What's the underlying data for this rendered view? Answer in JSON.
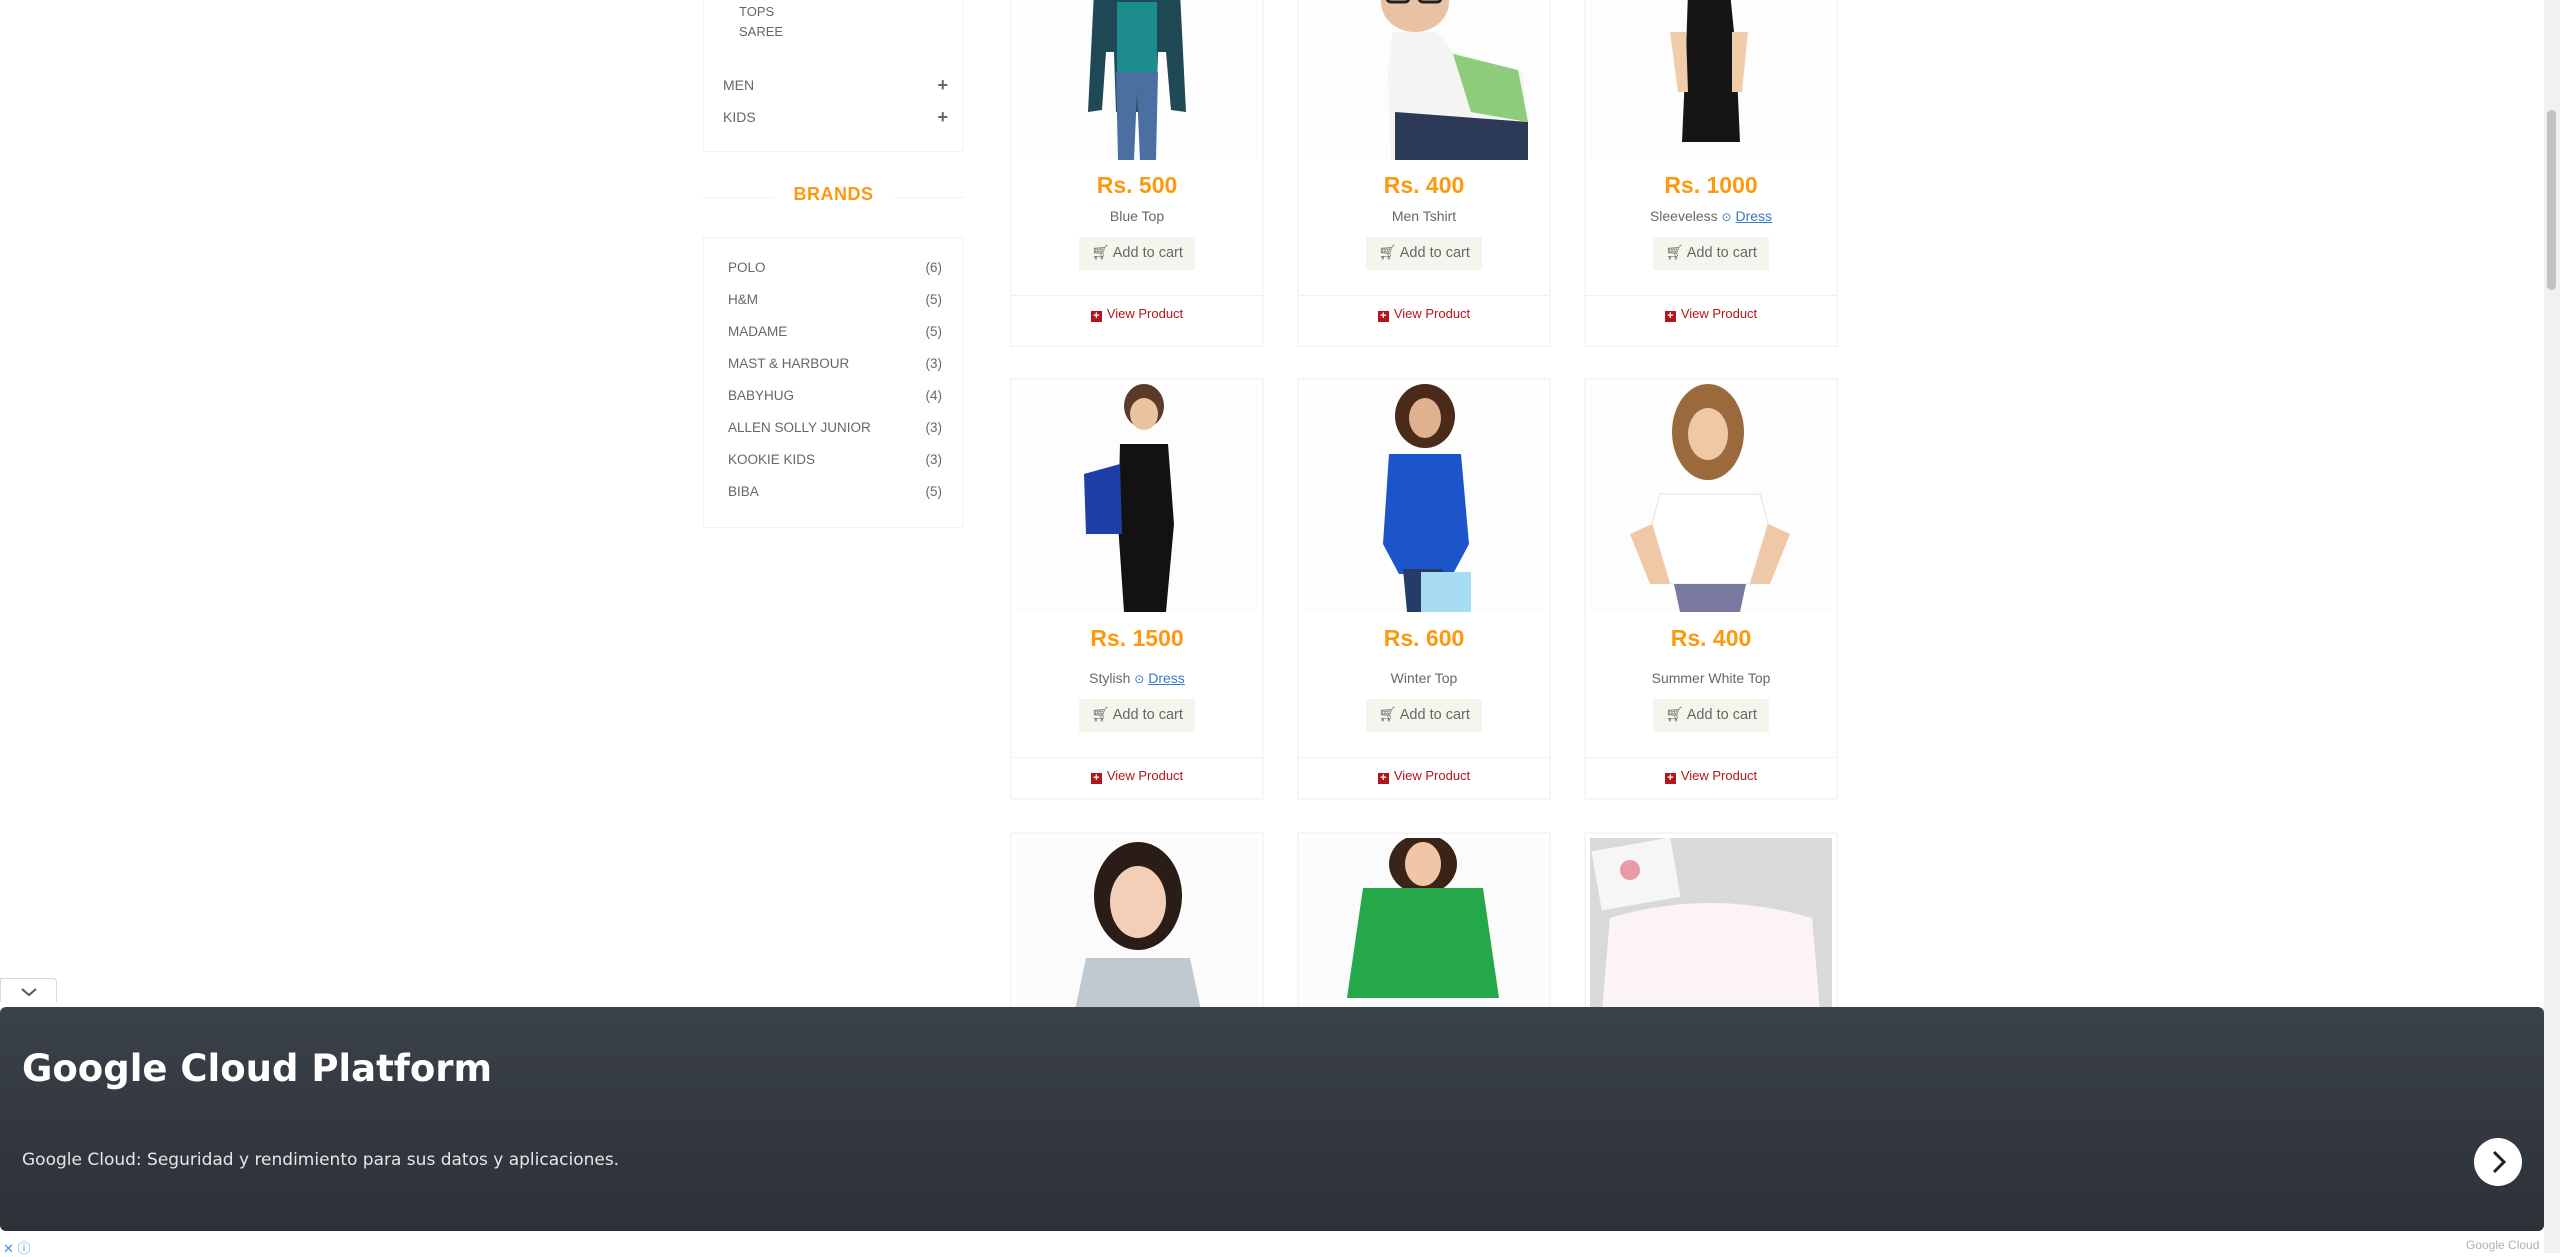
{
  "sidebar": {
    "subcategories": [
      "TOPS",
      "SAREE"
    ],
    "categories": [
      {
        "label": "MEN"
      },
      {
        "label": "KIDS"
      }
    ],
    "brands_title": "BRANDS",
    "brands": [
      {
        "name": "POLO",
        "count": "(6)"
      },
      {
        "name": "H&M",
        "count": "(5)"
      },
      {
        "name": "MADAME",
        "count": "(5)"
      },
      {
        "name": "MAST & HARBOUR",
        "count": "(3)"
      },
      {
        "name": "BABYHUG",
        "count": "(4)"
      },
      {
        "name": "ALLEN SOLLY JUNIOR",
        "count": "(3)"
      },
      {
        "name": "KOOKIE KIDS",
        "count": "(3)"
      },
      {
        "name": "BIBA",
        "count": "(5)"
      }
    ]
  },
  "products": [
    {
      "price": "Rs. 500",
      "name": "Blue Top",
      "link": ""
    },
    {
      "price": "Rs. 400",
      "name": "Men Tshirt",
      "link": ""
    },
    {
      "price": "Rs. 1000",
      "name": "Sleeveless",
      "link": "Dress"
    },
    {
      "price": "Rs. 1500",
      "name": "Stylish",
      "link": "Dress"
    },
    {
      "price": "Rs. 600",
      "name": "Winter Top",
      "link": ""
    },
    {
      "price": "Rs. 400",
      "name": "Summer White Top",
      "link": ""
    }
  ],
  "product_actions": {
    "add_to_cart": "Add to cart",
    "view_product": "View Product"
  },
  "ad": {
    "title": "Google Cloud Platform",
    "description": "Google Cloud: Seguridad y rendimiento para sus datos y aplicaciones.",
    "brand": "Google Cloud"
  },
  "colors": {
    "accent": "#fe980f",
    "view_link": "#b4151b",
    "ad_bg": "#343a41"
  }
}
